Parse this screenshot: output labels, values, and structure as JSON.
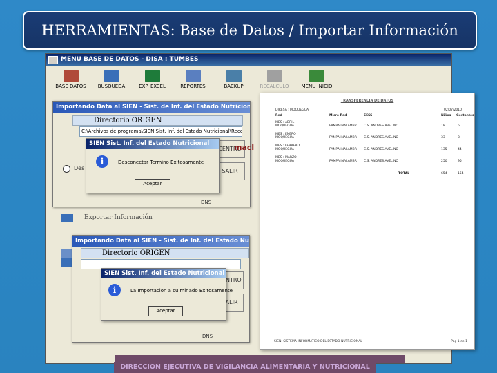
{
  "slide": {
    "title": "HERRAMIENTAS: Base de Datos / Importar Información",
    "footer": "DIRECCION EJECUTIVA DE VIGILANCIA ALIMENTARIA Y NUTRICIONAL"
  },
  "app": {
    "title": "MENU BASE DE DATOS -   DISA  :  TUMBES",
    "toolbar": [
      {
        "label": "BASE DATOS",
        "icon": "database-icon",
        "color": "#b04a3a",
        "enabled": true
      },
      {
        "label": "BUSQUEDA",
        "icon": "search-icon",
        "color": "#3a6fb8",
        "enabled": true
      },
      {
        "label": "EXP. EXCEL",
        "icon": "excel-icon",
        "color": "#1e7b3a",
        "enabled": true
      },
      {
        "label": "REPORTES",
        "icon": "report-icon",
        "color": "#5a7fc0",
        "enabled": true
      },
      {
        "label": "BACKUP",
        "icon": "backup-icon",
        "color": "#4a7fa8",
        "enabled": true
      },
      {
        "label": "RECALCULO",
        "icon": "recalc-icon",
        "color": "#a0a0a0",
        "enabled": false
      },
      {
        "label": "MENU INICIO",
        "icon": "exit-door-icon",
        "color": "#3a8a3a",
        "enabled": true
      }
    ]
  },
  "import_dialog_1": {
    "title": "Importando Data al SIEN - Sist. de Inf. del Estado Nutricional",
    "directory_header": "Directorio ORIGEN",
    "path": "C:\\Archivos de programa\\SIEN Sist. Inf. del Estado Nutricional\\Recep",
    "side_button": "CENTRO",
    "side_button_2": "SALIR",
    "partial_text": "macl",
    "radio_label": "Des",
    "export_label": "Exportar Información",
    "status": "DNS"
  },
  "msgbox_1": {
    "title": "SIEN Sist. Inf. del Estado Nutricional",
    "message": "Desconectar Termino Exitosamente",
    "ok": "Aceptar"
  },
  "import_dialog_2": {
    "title": "Importando Data al SIEN - Sist. de Inf. del Estado Nutricional",
    "directory_header": "Directorio ORIGEN",
    "side_button": "CENTRO",
    "side_button_2": "SALIR",
    "status": "DNS"
  },
  "msgbox_2": {
    "title": "SIEN Sist. Inf. del Estado Nutricional",
    "message": "La Importacion a culminado Exitosamente",
    "ok": "Aceptar"
  },
  "report": {
    "title": "TRANSFERENCIA DE DATOS",
    "location": "DIRESA :  MOQUEGUA",
    "date": "02/07/2010",
    "headers": [
      "Red",
      "Micro Red",
      "EESS",
      "Niños",
      "Gestantes"
    ],
    "rows": [
      {
        "month": "MES : ABRIL",
        "red": "MOQUEGUA",
        "micro": "PAMPA INALAMBR",
        "eess": "C.S. ANDRES AVELINO",
        "ninos": "18",
        "gest": "5"
      },
      {
        "month": "MES : ENERO",
        "red": "MOQUEGUA",
        "micro": "PAMPA INALAMBR",
        "eess": "C.S. ANDRES AVELINO",
        "ninos": "33",
        "gest": "3"
      },
      {
        "month": "MES : FEBRERO",
        "red": "MOQUEGUA",
        "micro": "PAMPA INALAMBR",
        "eess": "C.S. ANDRES AVELINO",
        "ninos": "135",
        "gest": "44"
      },
      {
        "month": "MES : MARZO",
        "red": "MOQUEGUA",
        "micro": "PAMPA INALAMBR",
        "eess": "C.S. ANDRES AVELINO",
        "ninos": "250",
        "gest": "95"
      }
    ],
    "total_label": "TOTAL :",
    "total_ninos": "654",
    "total_gest": "154",
    "footer": "SIEN: SISTEMA INFORMATICO DEL ESTADO NUTRICIONAL",
    "page": "Pág 1 de 1"
  }
}
